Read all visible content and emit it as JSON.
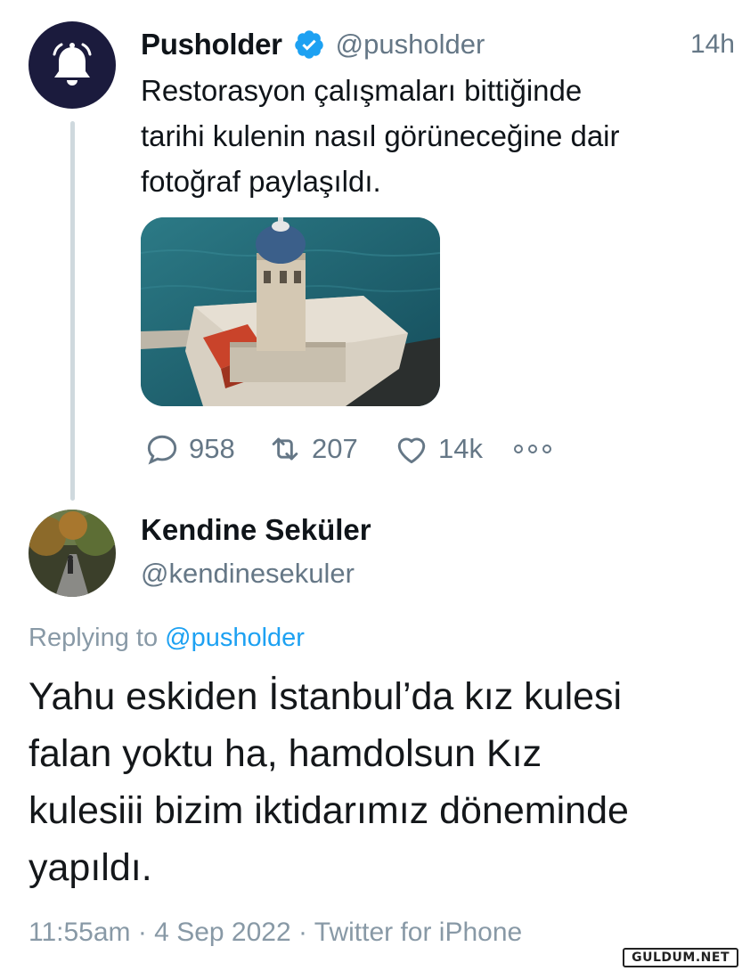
{
  "quoted_tweet": {
    "display_name": "Pusholder",
    "handle": "@pusholder",
    "time": "14h",
    "text": "Restorasyon çalışmaları bittiğinde\ntarihi kulenin nasıl görüneceğine dair\nfotoğraf paylaşıldı.",
    "avatar_icon": "bell-icon",
    "verified_icon": "verified-badge-icon",
    "stats": {
      "replies": "958",
      "retweets": "207",
      "likes": "14k"
    },
    "icons": [
      "reply-icon",
      "retweet-icon",
      "like-icon",
      "more-icon"
    ]
  },
  "reply_tweet": {
    "display_name": "Kendine Seküler",
    "handle": "@kendinesekuler",
    "replying_prefix": "Replying to",
    "replying_to": "@pusholder",
    "text": "Yahu eskiden İstanbul’da kız kulesi\nfalan yoktu ha, hamdolsun Kız\nkulesiii bizim iktidarımız döneminde\nyapıldı.",
    "meta": "11:55am · 4 Sep 2022 · Twitter for iPhone"
  },
  "watermark": "GULDUM.NET",
  "colors": {
    "verified": "#1da1f2",
    "link": "#1da1f2",
    "secondary_text": "#657786",
    "avatar_bg": "#1b1b3d",
    "thread_line": "#cfd9de"
  }
}
